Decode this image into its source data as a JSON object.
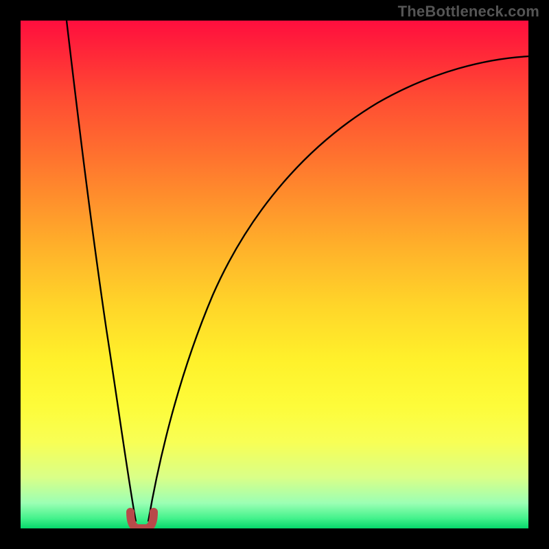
{
  "watermark": "TheBottleneck.com",
  "chart_data": {
    "type": "line",
    "title": "",
    "xlabel": "",
    "ylabel": "",
    "xlim": [
      0,
      100
    ],
    "ylim": [
      0,
      100
    ],
    "annotations": [],
    "note": "Axes shown without numeric tick labels; values below are read off the plotted curve pixel positions, with y=0 at bottom (green) and y=100 at top (red).",
    "series": [
      {
        "name": "bottleneck-curve-left",
        "x": [
          9.0,
          10.0,
          11.5,
          13.5,
          16.0,
          18.5,
          20.0,
          21.0
        ],
        "values": [
          99.5,
          89.0,
          75.0,
          58.0,
          37.0,
          16.0,
          5.0,
          1.0
        ]
      },
      {
        "name": "bottleneck-curve-right",
        "x": [
          24.0,
          25.0,
          27.0,
          30.0,
          35.0,
          42.0,
          50.0,
          58.0,
          66.0,
          75.0,
          85.0,
          95.0,
          100.0
        ],
        "values": [
          1.0,
          5.0,
          15.0,
          27.0,
          42.0,
          55.0,
          64.0,
          71.0,
          76.0,
          81.0,
          85.0,
          89.0,
          90.5
        ]
      },
      {
        "name": "optimal-marker",
        "x": [
          21.0,
          21.5,
          22.5,
          23.5,
          24.0
        ],
        "values": [
          3.5,
          0.8,
          0.5,
          0.8,
          3.5
        ]
      }
    ],
    "optimal_x": 22.5,
    "colors": {
      "curve": "#000000",
      "marker": "#b84a4a",
      "gradient_top": "#ff0e3e",
      "gradient_bottom": "#06d86b"
    }
  }
}
